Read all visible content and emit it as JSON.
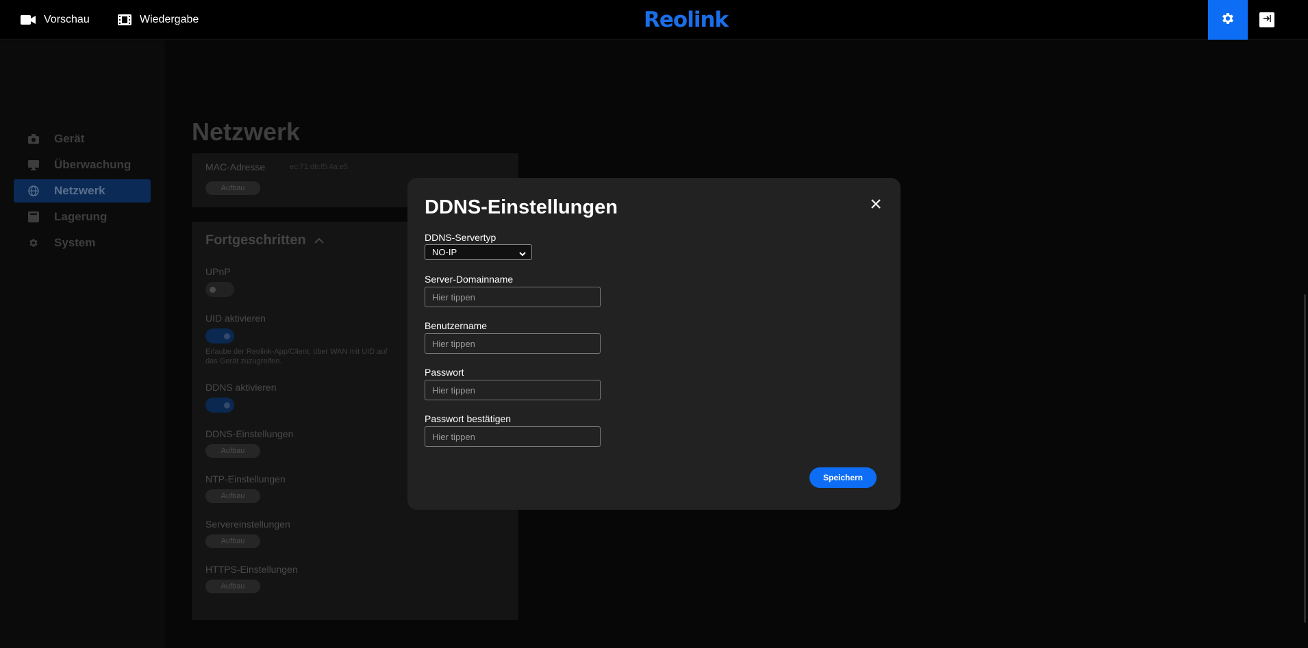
{
  "topbar": {
    "preview_label": "Vorschau",
    "playback_label": "Wiedergabe",
    "logo_text": "Reolink",
    "accent_color": "#0d6ef5"
  },
  "sidebar": {
    "items": [
      {
        "label": "Gerät",
        "icon": "camera-icon",
        "active": false
      },
      {
        "label": "Überwachung",
        "icon": "monitor-icon",
        "active": false
      },
      {
        "label": "Netzwerk",
        "icon": "globe-icon",
        "active": true
      },
      {
        "label": "Lagerung",
        "icon": "storage-icon",
        "active": false
      },
      {
        "label": "System",
        "icon": "gear-icon",
        "active": false
      }
    ]
  },
  "main": {
    "title": "Netzwerk",
    "mac_label": "MAC-Adresse",
    "mac_value": "ec:71:db:f5:4a:e5",
    "setup_label": "Aufbau",
    "advanced_title": "Fortgeschritten",
    "upnp_label": "UPnP",
    "upnp_enabled": false,
    "uid_label": "UID aktivieren",
    "uid_enabled": true,
    "uid_hint": "Erlaube der Reolink-App/Client, über WAN mit UID auf das Gerät zuzugreifen.",
    "ddns_enable_label": "DDNS aktivieren",
    "ddns_enabled": true,
    "ddns_settings_label": "DDNS-Einstellungen",
    "ntp_label": "NTP-Einstellungen",
    "server_label": "Servereinstellungen",
    "https_label": "HTTPS-Einstellungen"
  },
  "modal": {
    "title": "DDNS-Einstellungen",
    "server_type_label": "DDNS-Servertyp",
    "server_type_value": "NO-IP",
    "domain_label": "Server-Domainname",
    "username_label": "Benutzername",
    "password_label": "Passwort",
    "confirm_label": "Passwort bestätigen",
    "placeholder": "Hier tippen",
    "save_label": "Speichern"
  }
}
